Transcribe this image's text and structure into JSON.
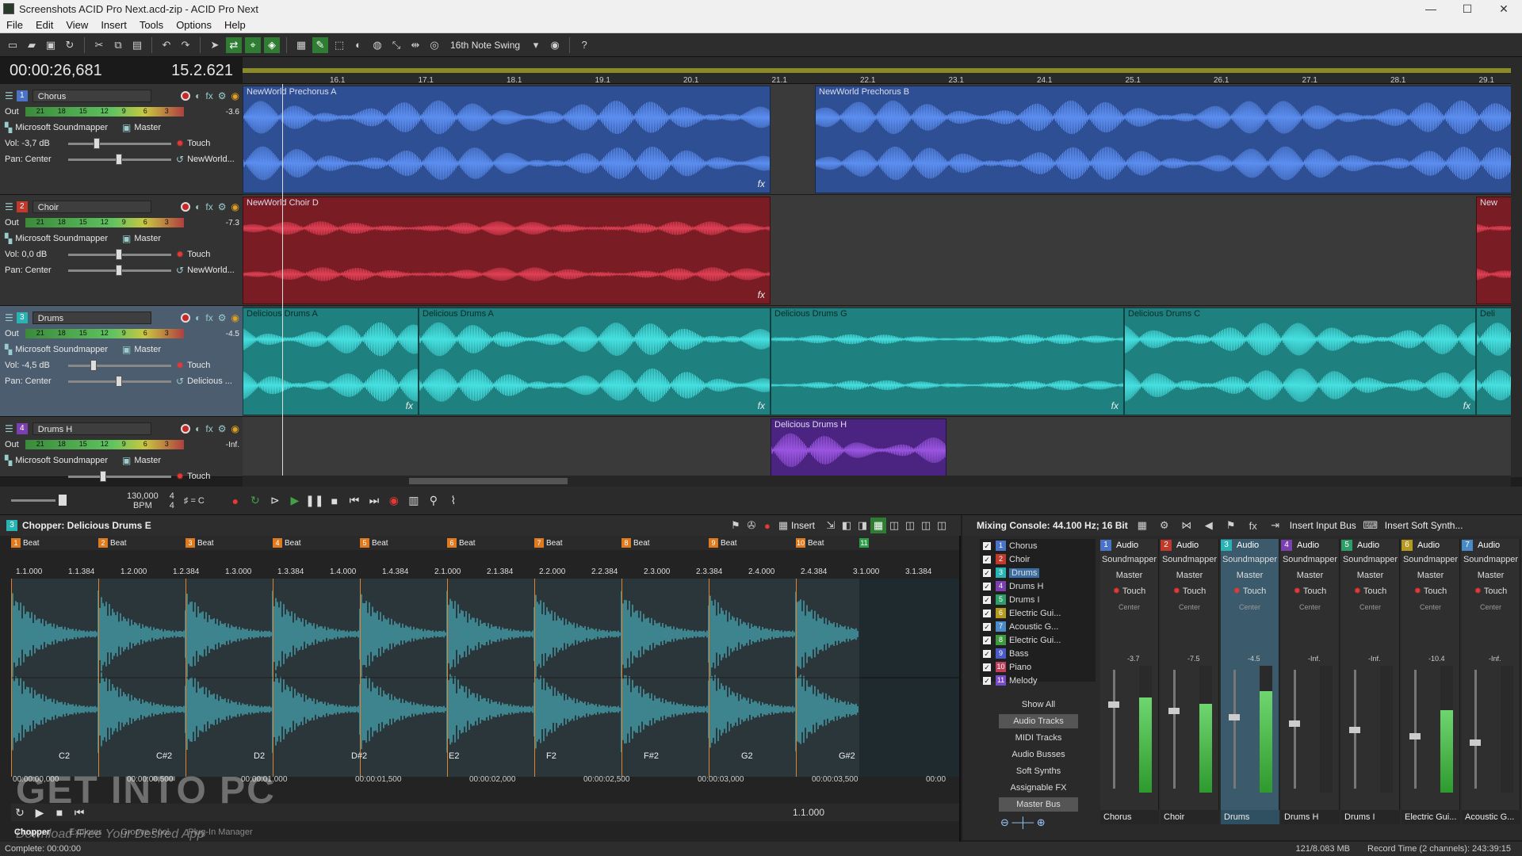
{
  "window": {
    "title": "Screenshots ACID Pro Next.acd-zip - ACID Pro Next",
    "min": "—",
    "max": "☐",
    "close": "✕"
  },
  "menu": [
    "File",
    "Edit",
    "View",
    "Insert",
    "Tools",
    "Options",
    "Help"
  ],
  "toolbar": {
    "swing_label": "16th Note Swing"
  },
  "time": {
    "position": "00:00:26,681",
    "measure": "15.2.621"
  },
  "ruler_ticks": [
    "16.1",
    "17.1",
    "18.1",
    "19.1",
    "20.1",
    "21.1",
    "22.1",
    "23.1",
    "24.1",
    "25.1",
    "26.1",
    "27.1",
    "28.1",
    "29.1"
  ],
  "tracks": [
    {
      "num": "1",
      "name": "Chorus",
      "color": "#4a73c8",
      "device": "Microsoft Soundmapper",
      "bus": "Master",
      "vol": "Vol:  -3,7 dB",
      "pan": "Pan:  Center",
      "mode": "Touch",
      "clip_label": "NewWorld...",
      "meter_val": "-3.6",
      "out": "Out",
      "clips": [
        {
          "name": "NewWorld Prechorus A"
        },
        {
          "name": "NewWorld Prechorus B"
        }
      ]
    },
    {
      "num": "2",
      "name": "Choir",
      "color": "#c0392b",
      "device": "Microsoft Soundmapper",
      "bus": "Master",
      "vol": "Vol:  0,0 dB",
      "pan": "Pan:  Center",
      "mode": "Touch",
      "clip_label": "NewWorld...",
      "meter_val": "-7.3",
      "out": "Out",
      "clips": [
        {
          "name": "NewWorld Choir D"
        },
        {
          "name": "New"
        }
      ]
    },
    {
      "num": "3",
      "name": "Drums",
      "color": "#2ab3b3",
      "device": "Microsoft Soundmapper",
      "bus": "Master",
      "vol": "Vol:  -4,5 dB",
      "pan": "Pan:  Center",
      "mode": "Touch",
      "clip_label": "Delicious ...",
      "meter_val": "-4.5",
      "out": "Out",
      "clips": [
        {
          "name": "Delicious Drums A"
        },
        {
          "name": "Delicious Drums A"
        },
        {
          "name": "Delicious Drums G"
        },
        {
          "name": "Delicious Drums C"
        },
        {
          "name": "Deli"
        }
      ]
    },
    {
      "num": "4",
      "name": "Drums H",
      "color": "#7b3fb0",
      "device": "Microsoft Soundmapper",
      "bus": "Master",
      "vol": "",
      "pan": "",
      "mode": "Touch",
      "clip_label": "",
      "meter_val": "-Inf.",
      "out": "Out",
      "clips": [
        {
          "name": "Delicious Drums H"
        }
      ]
    }
  ],
  "meter_scale": [
    "21",
    "18",
    "15",
    "12",
    "9",
    "6",
    "3"
  ],
  "tempo": {
    "bpm_value": "130,000",
    "bpm_label": "BPM",
    "ts_top": "4",
    "ts_bottom": "4",
    "key": "= C"
  },
  "chopper": {
    "title": "Chopper: Delicious Drums E",
    "insert_label": "Insert",
    "beats": [
      {
        "n": "1",
        "label": "Beat"
      },
      {
        "n": "2",
        "label": "Beat"
      },
      {
        "n": "3",
        "label": "Beat"
      },
      {
        "n": "4",
        "label": "Beat"
      },
      {
        "n": "5",
        "label": "Beat"
      },
      {
        "n": "6",
        "label": "Beat"
      },
      {
        "n": "7",
        "label": "Beat"
      },
      {
        "n": "8",
        "label": "Beat"
      },
      {
        "n": "9",
        "label": "Beat"
      },
      {
        "n": "10",
        "label": "Beat"
      },
      {
        "n": "11",
        "label": ""
      }
    ],
    "positions": [
      "1.1.000",
      "1.1.384",
      "1.2.000",
      "1.2.384",
      "1.3.000",
      "1.3.384",
      "1.4.000",
      "1.4.384",
      "2.1.000",
      "2.1.384",
      "2.2.000",
      "2.2.384",
      "2.3.000",
      "2.3.384",
      "2.4.000",
      "2.4.384",
      "3.1.000",
      "3.1.384"
    ],
    "notes": [
      "C2",
      "C#2",
      "D2",
      "D#2",
      "E2",
      "F2",
      "F#2",
      "G2",
      "G#2"
    ],
    "clock": [
      "00:00:00,000",
      "00:00:00,500",
      "00:00:01,000",
      "00:00:01,500",
      "00:00:02,000",
      "00:00:02,500",
      "00:00:03,000",
      "00:00:03,500",
      "00:00"
    ],
    "length": "1.1.000",
    "tabs": [
      "Chopper",
      "Explorer",
      "Groove Pool",
      "Plug-In Manager"
    ]
  },
  "mixer": {
    "title": "Mixing Console: 44.100 Hz; 16 Bit",
    "insert_input_bus": "Insert Input Bus",
    "insert_soft_synth": "Insert Soft Synth...",
    "list": [
      {
        "n": "1",
        "name": "Chorus",
        "color": "#4a73c8"
      },
      {
        "n": "2",
        "name": "Choir",
        "color": "#c0392b"
      },
      {
        "n": "3",
        "name": "Drums",
        "color": "#2ab3b3"
      },
      {
        "n": "4",
        "name": "Drums H",
        "color": "#7b3fb0"
      },
      {
        "n": "5",
        "name": "Drums I",
        "color": "#2e9d6a"
      },
      {
        "n": "6",
        "name": "Electric Gui...",
        "color": "#b59a1f"
      },
      {
        "n": "7",
        "name": "Acoustic G...",
        "color": "#4a8ac8"
      },
      {
        "n": "8",
        "name": "Electric Gui...",
        "color": "#3f9a3f"
      },
      {
        "n": "9",
        "name": "Bass",
        "color": "#4a5ac8"
      },
      {
        "n": "10",
        "name": "Piano",
        "color": "#c03f5a"
      },
      {
        "n": "11",
        "name": "Melody",
        "color": "#7a4ac8"
      }
    ],
    "buttons": [
      "Show All",
      "Audio Tracks",
      "MIDI Tracks",
      "Audio Busses",
      "Soft Synths",
      "Assignable FX",
      "Master Bus"
    ],
    "strips": [
      {
        "n": "1",
        "type": "Audio",
        "out": "Soundmapper",
        "bus": "Master",
        "mode": "Touch",
        "pan": "Center",
        "db": "-3.7",
        "level": "0.75",
        "foot": "Chorus",
        "color": "#4a73c8"
      },
      {
        "n": "2",
        "type": "Audio",
        "out": "Soundmapper",
        "bus": "Master",
        "mode": "Touch",
        "pan": "Center",
        "db": "-7.5",
        "level": "0.70",
        "foot": "Choir",
        "color": "#c0392b"
      },
      {
        "n": "3",
        "type": "Audio",
        "out": "Soundmapper",
        "bus": "Master",
        "mode": "Touch",
        "pan": "Center",
        "db": "-4.5",
        "level": "0.80",
        "foot": "Drums",
        "color": "#2ab3b3"
      },
      {
        "n": "4",
        "type": "Audio",
        "out": "Soundmapper",
        "bus": "Master",
        "mode": "Touch",
        "pan": "Center",
        "db": "-Inf.",
        "level": "0.0",
        "foot": "Drums H",
        "color": "#7b3fb0"
      },
      {
        "n": "5",
        "type": "Audio",
        "out": "Soundmapper",
        "bus": "Master",
        "mode": "Touch",
        "pan": "Center",
        "db": "-Inf.",
        "level": "0.0",
        "foot": "Drums I",
        "color": "#2e9d6a"
      },
      {
        "n": "6",
        "type": "Audio",
        "out": "Soundmapper",
        "bus": "Master",
        "mode": "Touch",
        "pan": "Center",
        "db": "-10.4",
        "level": "0.65",
        "foot": "Electric Gui...",
        "color": "#b59a1f"
      },
      {
        "n": "7",
        "type": "Audio",
        "out": "Soundmapper",
        "bus": "Master",
        "mode": "Touch",
        "pan": "Center",
        "db": "-Inf.",
        "level": "0.0",
        "foot": "Acoustic G...",
        "color": "#4a8ac8"
      }
    ]
  },
  "status": {
    "left": "Complete: 00:00:00",
    "mem": "121/8.083 MB",
    "record": "Record Time (2 channels): 243:39:15"
  },
  "watermark": {
    "main": "GET INTO PC",
    "sub": "Download Free Your Desired App"
  }
}
